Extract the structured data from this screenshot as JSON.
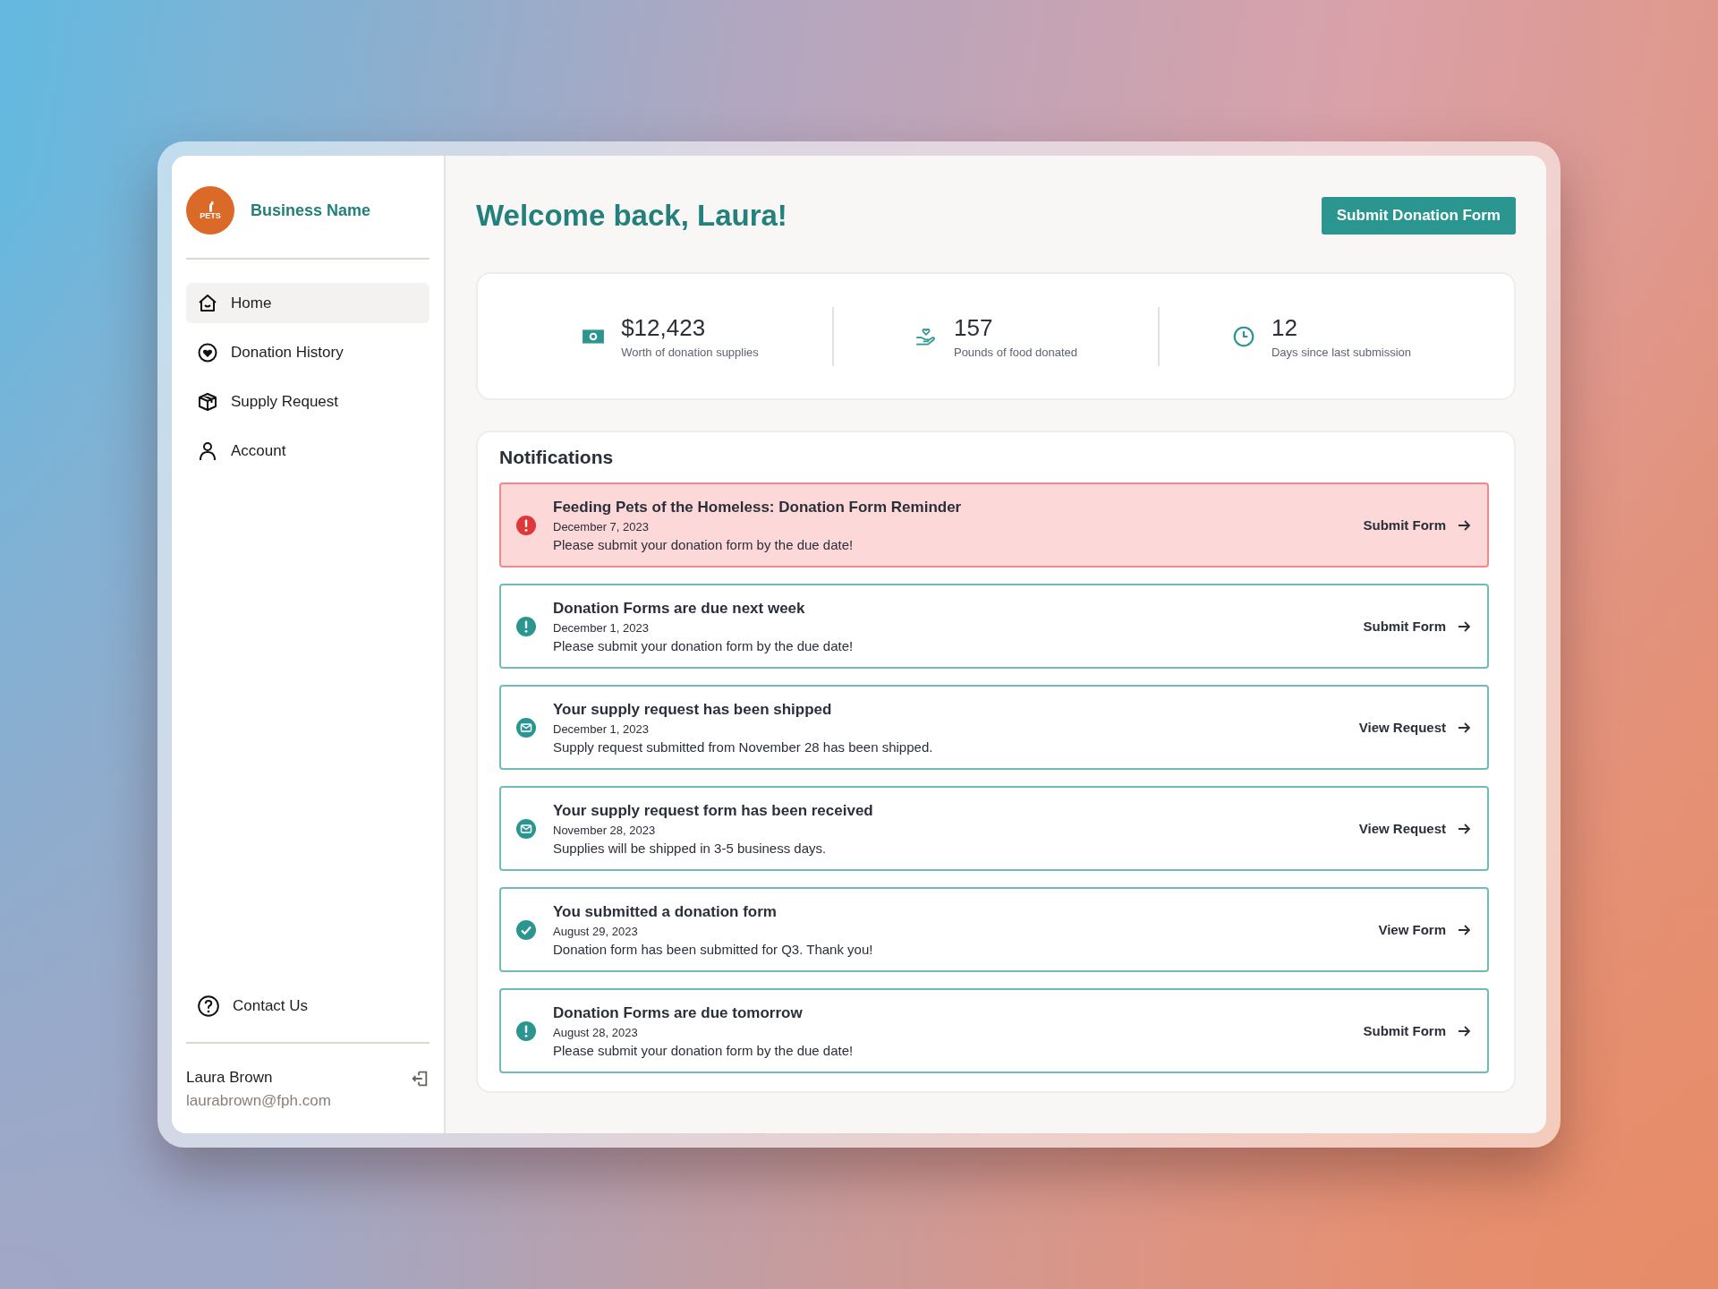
{
  "brand": {
    "logo_text": "PETS",
    "name": "Business Name"
  },
  "nav": [
    {
      "kind": "home",
      "label": "Home",
      "selected": true
    },
    {
      "kind": "heart",
      "label": "Donation History",
      "selected": false
    },
    {
      "kind": "box",
      "label": "Supply Request",
      "selected": false
    },
    {
      "kind": "person",
      "label": "Account",
      "selected": false
    }
  ],
  "contact": {
    "label": "Contact Us"
  },
  "user": {
    "name": "Laura Brown",
    "email": "laurabrown@fph.com"
  },
  "heading": "Welcome back, Laura!",
  "primary_button": "Submit Donation Form",
  "stats": [
    {
      "kind": "money",
      "value": "$12,423",
      "label": "Worth of donation supplies"
    },
    {
      "kind": "food",
      "value": "157",
      "label": "Pounds of food donated"
    },
    {
      "kind": "clock",
      "value": "12",
      "label": "Days since last submission"
    }
  ],
  "notifications_title": "Notifications",
  "notifications": [
    {
      "kind": "urgent",
      "title": "Feeding Pets of the Homeless: Donation Form Reminder",
      "date": "December 7, 2023",
      "message": "Please submit your donation form by the due date!",
      "action": "Submit Form"
    },
    {
      "kind": "alert",
      "title": "Donation Forms are due next week",
      "date": "December 1, 2023",
      "message": "Please submit your donation form by the due date!",
      "action": "Submit Form"
    },
    {
      "kind": "mail",
      "title": "Your supply request has been shipped",
      "date": "December 1, 2023",
      "message": "Supply request submitted from November 28 has been shipped.",
      "action": "View Request"
    },
    {
      "kind": "mail",
      "title": "Your supply request form has been received",
      "date": "November 28, 2023",
      "message": "Supplies will be shipped in 3-5 business days.",
      "action": "View Request"
    },
    {
      "kind": "done",
      "title": "You submitted a donation form",
      "date": "August 29, 2023",
      "message": "Donation form has been submitted for Q3. Thank you!",
      "action": "View Form"
    },
    {
      "kind": "alert",
      "title": "Donation Forms are due tomorrow",
      "date": "August 28, 2023",
      "message": "Please submit your donation form by the due date!",
      "action": "Submit Form"
    }
  ]
}
